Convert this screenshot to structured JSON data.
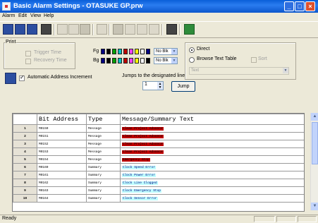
{
  "window": {
    "title": "Basic Alarm Settings - OTASUKE GP.prw"
  },
  "menu": [
    "Alarm",
    "Edit",
    "View",
    "Help"
  ],
  "print": {
    "label": "Print",
    "trigger_time": "Trigger Time",
    "recovery_time": "Recovery Time"
  },
  "colors": {
    "fg_label": "Fg",
    "bg_label": "Bg",
    "fg_swatches": [
      "#000080",
      "#000000",
      "#00a000",
      "#00c0c0",
      "#c00000",
      "#ff40ff",
      "#ffff00",
      "#ffffff",
      "#000080"
    ],
    "bg_swatches": [
      "#000080",
      "#000000",
      "#00a000",
      "#00c0c0",
      "#c00000",
      "#ff40ff",
      "#ffff00",
      "#ffffff",
      "#000000"
    ],
    "fg_blink": "No Blk",
    "bg_blink": "No Blk"
  },
  "direct": {
    "direct_label": "Direct",
    "browse_label": "Browse Text Table",
    "sort_label": "Sort",
    "table_value": "Text"
  },
  "auto_increment": {
    "label": "Automatic Address Increment",
    "checked": true
  },
  "jump": {
    "label": "Jumps to the designated line",
    "value": "1",
    "button": "Jump"
  },
  "table": {
    "headers": [
      "",
      "Bit Address",
      "Type",
      "Message/Summary Text"
    ],
    "rows": [
      {
        "num": "1",
        "address": "M0150",
        "type": "Message",
        "text": "Clean Project Advance",
        "fg": "#000000",
        "bg": "#c00000"
      },
      {
        "num": "2",
        "address": "M0151",
        "type": "Message",
        "text": "Clean Project Advance",
        "fg": "#000000",
        "bg": "#c00000"
      },
      {
        "num": "3",
        "address": "M0152",
        "type": "Message",
        "text": "Clean Project Advance",
        "fg": "#000000",
        "bg": "#c00000"
      },
      {
        "num": "4",
        "address": "M0153",
        "type": "Message",
        "text": "Clean Project Advance",
        "fg": "#000000",
        "bg": "#c00000"
      },
      {
        "num": "5",
        "address": "M0154",
        "type": "Message",
        "text": "Emergency Stop",
        "fg": "#000000",
        "bg": "#c00000"
      },
      {
        "num": "6",
        "address": "M0160",
        "type": "Summary",
        "text": "Clock Speed Error",
        "fg": "#000080",
        "bg": "#c0ffff"
      },
      {
        "num": "7",
        "address": "M0161",
        "type": "Summary",
        "text": "Clock Power Error",
        "fg": "#000080",
        "bg": "#c0ffff"
      },
      {
        "num": "8",
        "address": "M0162",
        "type": "Summary",
        "text": "Clock Line Clogged",
        "fg": "#000080",
        "bg": "#c0ffff"
      },
      {
        "num": "9",
        "address": "M0163",
        "type": "Summary",
        "text": "Clock Emergency Stop",
        "fg": "#000080",
        "bg": "#c0ffff"
      },
      {
        "num": "10",
        "address": "M0164",
        "type": "Summary",
        "text": "Clock Sensor Error",
        "fg": "#000080",
        "bg": "#c0ffff"
      }
    ]
  },
  "status": {
    "text": "Ready"
  }
}
